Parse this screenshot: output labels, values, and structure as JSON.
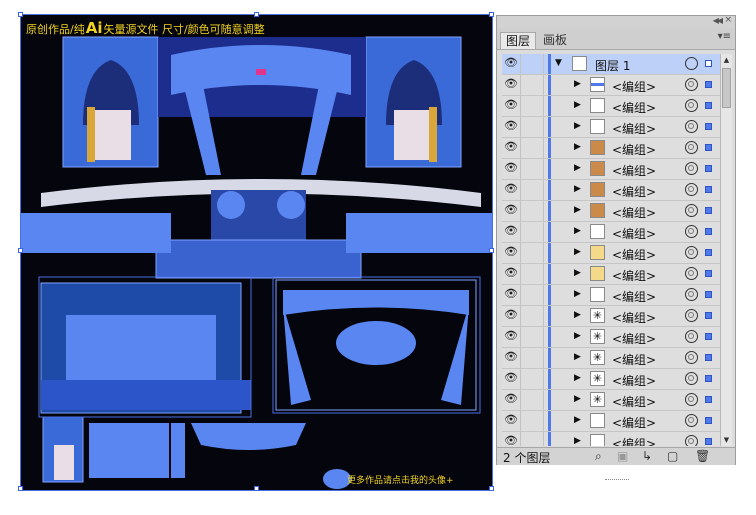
{
  "artboard": {
    "caption_prefix": "原创作品/纯",
    "caption_ai": "Ai",
    "caption_rest": "矢量源文件  尺寸/颜色可随意调整",
    "bottom_caption": "更多作品请点击我的头像+",
    "colors": {
      "background": "#05050d",
      "selection": "#4a6fe3",
      "fill": "#5a86f2",
      "caption": "#f2d320"
    }
  },
  "panel": {
    "tabs": [
      "图层",
      "画板"
    ],
    "active_tab": "图层",
    "layer_name": "图层 1",
    "group_label": "<编组>",
    "footer_count": "2 个图层",
    "footer_icons": [
      "search-icon",
      "clipping-mask-icon",
      "new-sublayer-icon",
      "new-layer-icon",
      "trash-icon"
    ],
    "layer_color": "#4f78e8",
    "thumbnails": [
      "blue-bar",
      "plain",
      "plain",
      "gold",
      "gold",
      "gold",
      "gold",
      "plain",
      "yellow",
      "yellow",
      "plain",
      "star",
      "star",
      "star",
      "star",
      "star",
      "plain",
      "plain"
    ]
  }
}
